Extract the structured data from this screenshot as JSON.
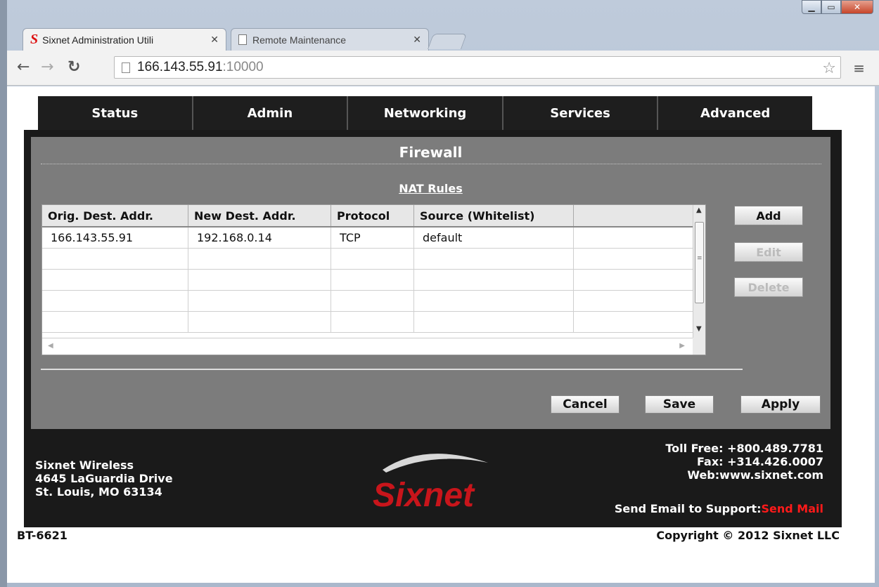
{
  "browser": {
    "tabs": [
      {
        "title": "Sixnet Administration Utili",
        "active": true
      },
      {
        "title": "Remote Maintenance",
        "active": false
      }
    ],
    "url_host": "166.143.55.91",
    "url_port": ":10000"
  },
  "nav": {
    "items": [
      "Status",
      "Admin",
      "Networking",
      "Services",
      "Advanced"
    ]
  },
  "page": {
    "title": "Firewall",
    "table_caption": "NAT Rules"
  },
  "table": {
    "columns": [
      "Orig. Dest. Addr.",
      "New Dest. Addr.",
      "Protocol",
      "Source (Whitelist)",
      ""
    ],
    "rows": [
      [
        "166.143.55.91",
        "192.168.0.14",
        "TCP",
        "default",
        ""
      ],
      [
        "",
        "",
        "",
        "",
        ""
      ],
      [
        "",
        "",
        "",
        "",
        ""
      ],
      [
        "",
        "",
        "",
        "",
        ""
      ],
      [
        "",
        "",
        "",
        "",
        ""
      ]
    ]
  },
  "side_buttons": {
    "add": "Add",
    "edit": "Edit",
    "delete": "Delete"
  },
  "actions": {
    "cancel": "Cancel",
    "save": "Save",
    "apply": "Apply"
  },
  "footer": {
    "company": "Sixnet Wireless",
    "street": "4645 LaGuardia Drive",
    "city": "St. Louis, MO 63134",
    "toll_free": "Toll Free: +800.489.7781",
    "fax": "Fax: +314.426.0007",
    "web": "Web:www.sixnet.com",
    "support_label": "Send Email to Support:",
    "support_link": "Send Mail",
    "logo_text": "Sixnet"
  },
  "bottom": {
    "model": "BT-6621",
    "copyright": "Copyright © 2012 Sixnet LLC"
  },
  "colors": {
    "nav_bg": "#1e1e1e",
    "panel_bg": "#7c7c7c",
    "footer_bg": "#1a1a1a",
    "logo_red": "#c8151b",
    "link_red": "#ff1a1a"
  }
}
